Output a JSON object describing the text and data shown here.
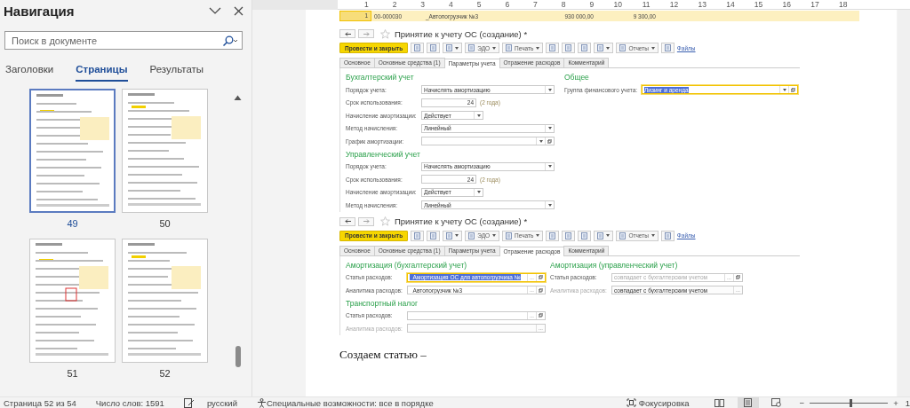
{
  "navigation": {
    "title": "Навигация",
    "search": {
      "placeholder": "Поиск в документе"
    },
    "tabs": [
      {
        "label": "Заголовки",
        "selected": false
      },
      {
        "label": "Страницы",
        "selected": true
      },
      {
        "label": "Результаты",
        "selected": false
      }
    ],
    "pages": [
      {
        "label": "49",
        "selected": true
      },
      {
        "label": "50",
        "selected": false
      },
      {
        "label": "51",
        "selected": false
      },
      {
        "label": "52",
        "selected": false
      }
    ]
  },
  "ruler": {
    "marks": [
      "1",
      "2",
      "3",
      "4",
      "5",
      "6",
      "7",
      "8",
      "9",
      "10",
      "11",
      "12",
      "13",
      "14",
      "15",
      "16",
      "17",
      "18"
    ]
  },
  "document": {
    "table_row": {
      "cells": [
        "1",
        "00-000030",
        "_Автопогрузчик №3",
        "930 000,00",
        "9 300,00"
      ]
    },
    "forms": [
      {
        "title": "Принятие к учету ОС (создание) *",
        "toolbar": [
          {
            "kind": "primary",
            "label": "Провести и закрыть"
          },
          {
            "kind": "icon"
          },
          {
            "kind": "icon"
          },
          {
            "kind": "icon_menu"
          },
          {
            "kind": "menu",
            "label": "ЭДО"
          },
          {
            "kind": "menu",
            "label": "Печать"
          },
          {
            "kind": "icon"
          },
          {
            "kind": "icon"
          },
          {
            "kind": "icon"
          },
          {
            "kind": "icon_menu"
          },
          {
            "kind": "menu",
            "label": "Отчеты"
          },
          {
            "kind": "icon"
          },
          {
            "kind": "link",
            "label": "Файлы"
          }
        ],
        "tabs": [
          {
            "label": "Основное",
            "selected": false
          },
          {
            "label": "Основные средства (1)",
            "selected": false
          },
          {
            "label": "Параметры учета",
            "selected": true
          },
          {
            "label": "Отражение расходов",
            "selected": false
          },
          {
            "label": "Комментарий",
            "selected": false
          }
        ],
        "columns": [
          {
            "sections": [
              {
                "title": "Бухгалтерский учет",
                "fields": [
                  {
                    "label": "Порядок учета:",
                    "kind": "select",
                    "value": "Начислять амортизацию",
                    "open_button": false,
                    "disabled": false,
                    "focused": false
                  },
                  {
                    "label": "Срок использования:",
                    "kind": "number",
                    "value": "24",
                    "hint": "(2 года)",
                    "disabled": false,
                    "focused": false
                  },
                  {
                    "label": "Начисление амортизации:",
                    "kind": "short_select",
                    "value": "Действует",
                    "disabled": false,
                    "focused": false
                  },
                  {
                    "label": "Метод начисления:",
                    "kind": "select",
                    "value": "Линейный",
                    "open_button": false,
                    "disabled": false,
                    "focused": false
                  },
                  {
                    "label": "График амортизации:",
                    "kind": "select",
                    "open_button": true,
                    "disabled": false,
                    "focused": false
                  }
                ]
              },
              {
                "title": "Управленческий учет",
                "fields": [
                  {
                    "label": "Порядок учета:",
                    "kind": "select",
                    "value": "Начислять амортизацию",
                    "open_button": false,
                    "disabled": false,
                    "focused": false
                  },
                  {
                    "label": "Срок использования:",
                    "kind": "number",
                    "value": "24",
                    "hint": "(2 года)",
                    "disabled": false,
                    "focused": false
                  },
                  {
                    "label": "Начисление амортизации:",
                    "kind": "short_select",
                    "value": "Действует",
                    "disabled": false,
                    "focused": false
                  },
                  {
                    "label": "Метод начисления:",
                    "kind": "select",
                    "value": "Линейный",
                    "open_button": false,
                    "disabled": false,
                    "focused": false
                  }
                ]
              }
            ]
          },
          {
            "sections": [
              {
                "title": "Общее",
                "fields": [
                  {
                    "label": "Группа финансового учета:",
                    "kind": "select",
                    "value": "Лизинг и аренда",
                    "open_button": true,
                    "disabled": false,
                    "focused": true
                  }
                ]
              }
            ]
          }
        ]
      },
      {
        "title": "Принятие к учету ОС (создание) *",
        "toolbar": [
          {
            "kind": "primary",
            "label": "Провести и закрыть"
          },
          {
            "kind": "icon"
          },
          {
            "kind": "icon"
          },
          {
            "kind": "icon_menu"
          },
          {
            "kind": "menu",
            "label": "ЭДО"
          },
          {
            "kind": "menu",
            "label": "Печать"
          },
          {
            "kind": "icon"
          },
          {
            "kind": "icon"
          },
          {
            "kind": "icon"
          },
          {
            "kind": "icon_menu"
          },
          {
            "kind": "menu",
            "label": "Отчеты"
          },
          {
            "kind": "icon"
          },
          {
            "kind": "link",
            "label": "Файлы"
          }
        ],
        "tabs": [
          {
            "label": "Основное",
            "selected": false
          },
          {
            "label": "Основные средства (1)",
            "selected": false
          },
          {
            "label": "Параметры учета",
            "selected": false
          },
          {
            "label": "Отражение расходов",
            "selected": true
          },
          {
            "label": "Комментарий",
            "selected": false
          }
        ],
        "columns": [
          {
            "sections": [
              {
                "title": "Амортизация (бухгалтерский учет)",
                "fields": [
                  {
                    "label": "Статья расходов:",
                    "kind": "lookup",
                    "value": "_Амортизация ОС для автопогрузчика №",
                    "choose": "...",
                    "open_button": true,
                    "disabled": false,
                    "focused": true
                  },
                  {
                    "label": "Аналитика расходов:",
                    "kind": "lookup",
                    "value": "_Автопогрузчик №3",
                    "choose": "...",
                    "open_button": true,
                    "disabled": false,
                    "focused": false
                  }
                ]
              },
              {
                "title": "Транспортный налог",
                "fields": [
                  {
                    "label": "Статья расходов:",
                    "kind": "lookup",
                    "choose": "...",
                    "open_button": true,
                    "disabled": false,
                    "focused": false
                  },
                  {
                    "label": "Аналитика расходов:",
                    "kind": "lookup",
                    "choose": "...",
                    "open_button": false,
                    "disabled": true,
                    "focused": false
                  }
                ]
              }
            ]
          },
          {
            "sections": [
              {
                "title": "Амортизация (управленческий учет)",
                "fields": [
                  {
                    "label": "Статья расходов:",
                    "kind": "lookup",
                    "placeholder": "совпадает с бухгалтерским учетом",
                    "choose": "...",
                    "open_button": true,
                    "disabled": false,
                    "focused": false
                  },
                  {
                    "label": "Аналитика расходов:",
                    "kind": "lookup",
                    "value": "совпадает с бухгалтерским учетом",
                    "choose": "...",
                    "open_button": false,
                    "disabled": true,
                    "focused": false
                  }
                ]
              }
            ]
          }
        ]
      }
    ],
    "paragraph": "Создаем статью –"
  },
  "status_bar": {
    "page": "Страница 52 из 54",
    "words": "Число слов: 1591",
    "language": "русский",
    "accessibility": "Специальные возможности: все в порядке",
    "focus": "Фокусировка",
    "views": [
      {
        "kind": "read",
        "selected": false
      },
      {
        "kind": "print",
        "selected": true
      },
      {
        "kind": "web",
        "selected": false
      }
    ],
    "zoom": {
      "minus": "−",
      "plus": "+",
      "level": 0.51,
      "percent": "1"
    }
  }
}
